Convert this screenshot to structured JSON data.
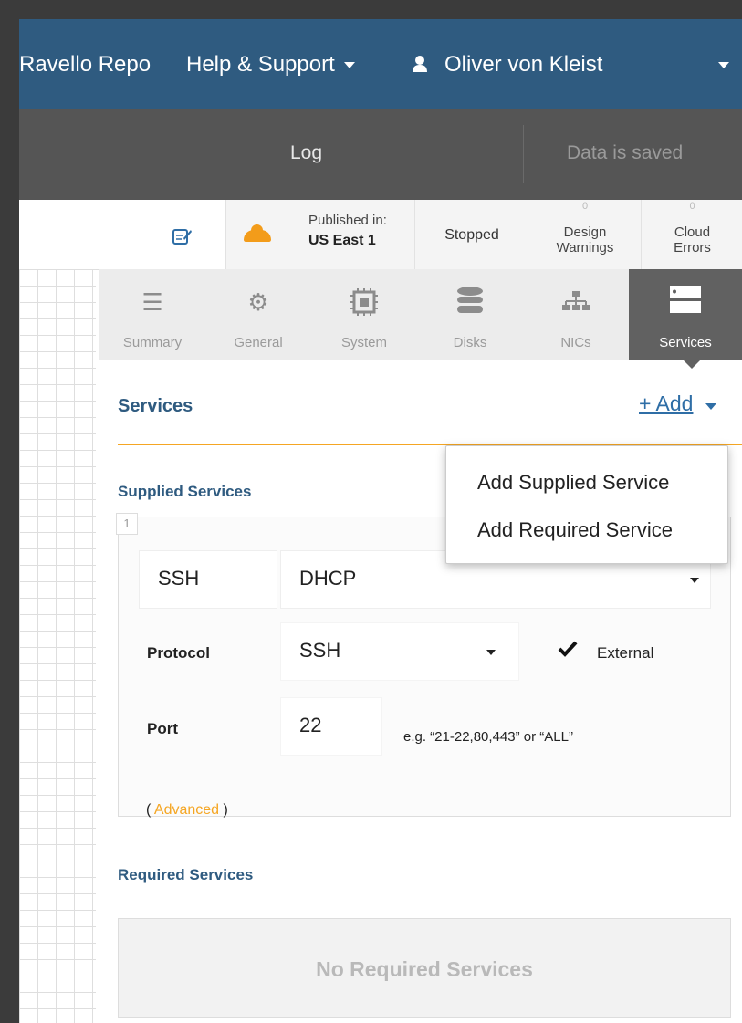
{
  "topnav": {
    "repo": "Ravello Repo",
    "help": "Help & Support",
    "user": "Oliver von Kleist"
  },
  "toolbar": {
    "log": "Log",
    "status": "Data is saved"
  },
  "statusbar": {
    "published_label": "Published in:",
    "published_region": "US East 1",
    "state": "Stopped",
    "design_warnings_count": "0",
    "design_warnings_line1": "Design",
    "design_warnings_line2": "Warnings",
    "cloud_errors_count": "0",
    "cloud_errors_line1": "Cloud",
    "cloud_errors_line2": "Errors"
  },
  "tabs": [
    {
      "label": "Summary",
      "icon": "list-icon"
    },
    {
      "label": "General",
      "icon": "gears-icon"
    },
    {
      "label": "System",
      "icon": "chip-icon"
    },
    {
      "label": "Disks",
      "icon": "database-icon"
    },
    {
      "label": "NICs",
      "icon": "network-icon"
    },
    {
      "label": "Services",
      "icon": "server-icon",
      "active": true
    }
  ],
  "services": {
    "title": "Services",
    "add_label": "+ Add",
    "supplied_label": "Supplied Services",
    "supplied_index": "1",
    "service_name": "SSH",
    "service_ip": "DHCP",
    "protocol_label": "Protocol",
    "protocol_value": "SSH",
    "external_label": "External",
    "external_checked": true,
    "port_label": "Port",
    "port_value": "22",
    "port_hint": "e.g. “21-22,80,443” or “ALL”",
    "advanced_open": "(",
    "advanced_label": "Advanced",
    "advanced_close": ")",
    "required_label": "Required Services",
    "required_empty": "No Required Services"
  },
  "add_menu": {
    "items": [
      "Add Supplied Service",
      "Add Required Service"
    ]
  },
  "colors": {
    "nav_blue": "#2f5b80",
    "toolbar_gray": "#555555",
    "accent_orange": "#f5a623",
    "link_blue": "#2f6ea6",
    "active_tab": "#616161"
  }
}
